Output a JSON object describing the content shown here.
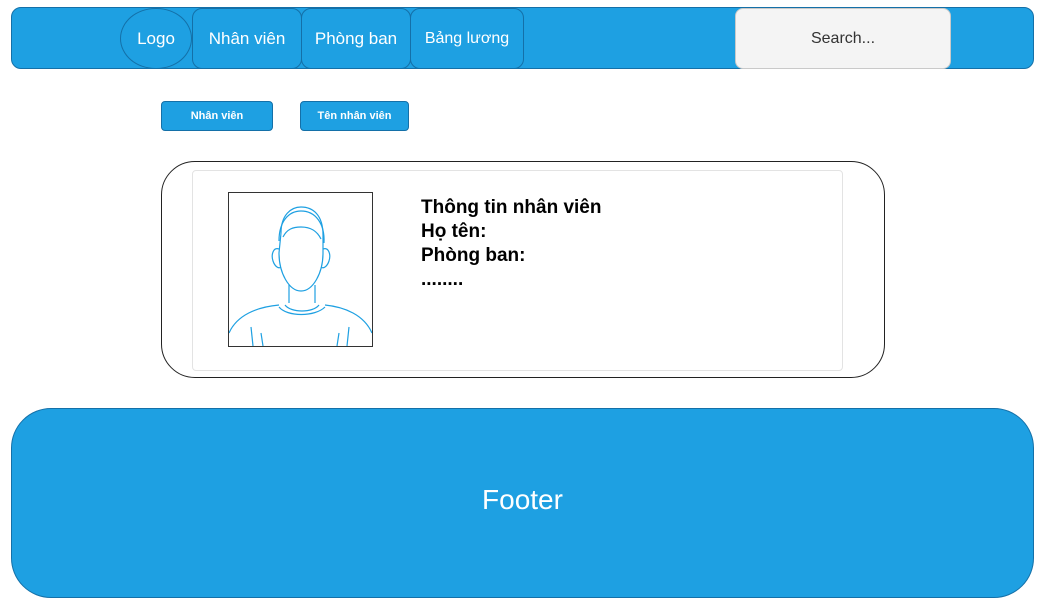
{
  "nav": {
    "logo": "Logo",
    "items": [
      "Nhân viên",
      "Phòng ban",
      "Bảng lương"
    ],
    "search_placeholder": "Search..."
  },
  "breadcrumb": [
    "Nhân viên",
    "Tên nhân viên"
  ],
  "employee": {
    "title": "Thông tin nhân viên",
    "name_label": "Họ tên:",
    "dept_label": "Phòng ban:",
    "more": "........",
    "avatar_icon": "person-silhouette-icon"
  },
  "footer": {
    "label": "Footer"
  },
  "colors": {
    "accent": "#1ea0e2",
    "border": "#1470a8",
    "line": "#1ea0e2"
  }
}
